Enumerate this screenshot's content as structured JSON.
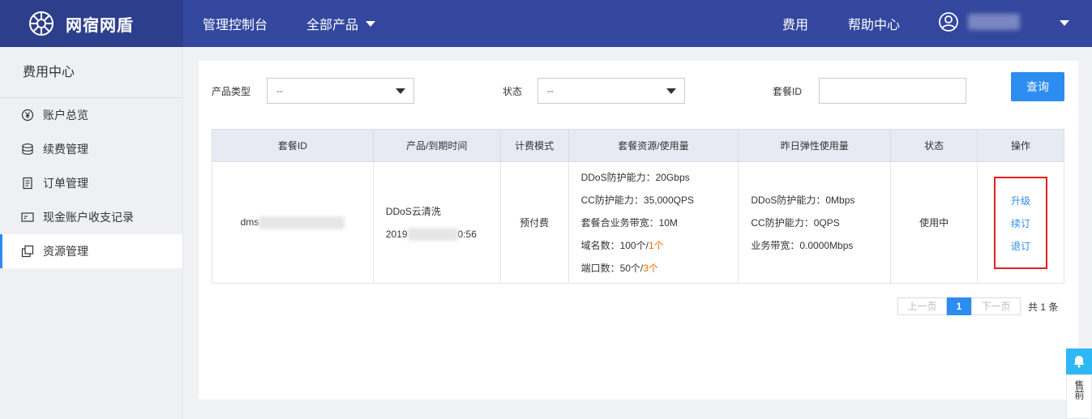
{
  "topbar": {
    "brand": "网宿网盾",
    "console": "管理控制台",
    "products": "全部产品",
    "fee": "费用",
    "help": "帮助中心"
  },
  "sidebar": {
    "title": "费用中心",
    "items": [
      {
        "label": "账户总览",
        "icon": "yen-circle-icon"
      },
      {
        "label": "续费管理",
        "icon": "database-icon"
      },
      {
        "label": "订单管理",
        "icon": "document-icon"
      },
      {
        "label": "现金账户收支记录",
        "icon": "card-icon"
      },
      {
        "label": "资源管理",
        "icon": "copy-icon"
      }
    ]
  },
  "filters": {
    "product_type_label": "产品类型",
    "product_type_value": "--",
    "status_label": "状态",
    "status_value": "--",
    "package_id_label": "套餐ID",
    "package_id_value": "",
    "query_button": "查询"
  },
  "table": {
    "headers": [
      "套餐ID",
      "产品/到期时间",
      "计费模式",
      "套餐资源/使用量",
      "昨日弹性使用量",
      "状态",
      "操作"
    ],
    "row": {
      "package_id_prefix": "dms",
      "product": "DDoS云清洗",
      "expiry_prefix": "2019",
      "expiry_suffix": "0:56",
      "billing_mode": "预付费",
      "resources": {
        "ddos": "DDoS防护能力：20Gbps",
        "cc": "CC防护能力：35,000QPS",
        "bandwidth": "套餐合业务带宽：10M",
        "domains_prefix": "域名数：100个/",
        "domains_used": "1个",
        "ports_prefix": "端口数：50个/",
        "ports_used": "3个"
      },
      "elastic": {
        "ddos": "DDoS防护能力：0Mbps",
        "cc": "CC防护能力：0QPS",
        "bandwidth": "业务带宽：0.0000Mbps"
      },
      "status": "使用中",
      "ops": [
        "升级",
        "续订",
        "退订"
      ]
    }
  },
  "pager": {
    "prev": "上一页",
    "current": "1",
    "next": "下一页",
    "total": "共 1 条"
  },
  "float_service": {
    "label": "售前"
  },
  "colors": {
    "topbar": "#33479e",
    "brand_bg": "#2c3e8c",
    "accent": "#2d8cf0",
    "highlight_box": "#e02020",
    "orange": "#ff6a00"
  }
}
